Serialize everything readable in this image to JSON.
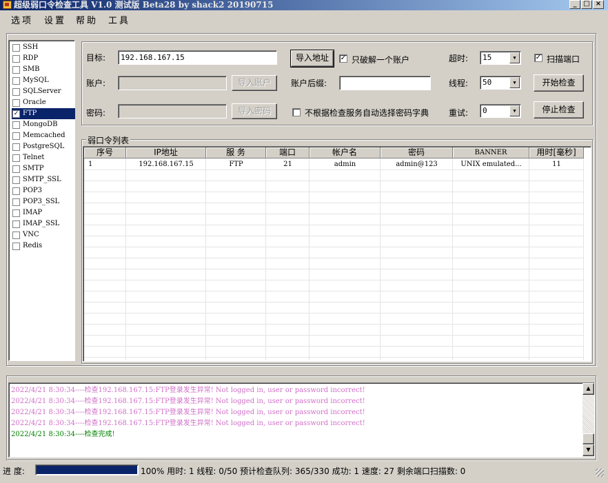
{
  "window": {
    "title": "超级弱口令检查工具 V1.0 测试版 Beta28 by shack2 20190715"
  },
  "menu": [
    "选项",
    "设置",
    "帮助",
    "工具"
  ],
  "services": [
    {
      "label": "SSH",
      "checked": false
    },
    {
      "label": "RDP",
      "checked": false
    },
    {
      "label": "SMB",
      "checked": false
    },
    {
      "label": "MySQL",
      "checked": false
    },
    {
      "label": "SQLServer",
      "checked": false
    },
    {
      "label": "Oracle",
      "checked": false
    },
    {
      "label": "FTP",
      "checked": true
    },
    {
      "label": "MongoDB",
      "checked": false
    },
    {
      "label": "Memcached",
      "checked": false
    },
    {
      "label": "PostgreSQL",
      "checked": false
    },
    {
      "label": "Telnet",
      "checked": false
    },
    {
      "label": "SMTP",
      "checked": false
    },
    {
      "label": "SMTP_SSL",
      "checked": false
    },
    {
      "label": "POP3",
      "checked": false
    },
    {
      "label": "POP3_SSL",
      "checked": false
    },
    {
      "label": "IMAP",
      "checked": false
    },
    {
      "label": "IMAP_SSL",
      "checked": false
    },
    {
      "label": "VNC",
      "checked": false
    },
    {
      "label": "Redis",
      "checked": false
    }
  ],
  "form": {
    "target_label": "目标:",
    "target_value": "192.168.167.15",
    "import_address": "导入地址",
    "only_one_account": "只破解一个账户",
    "account_label": "账户:",
    "account_value": "",
    "import_account": "导入账户",
    "account_suffix_label": "账户后缀:",
    "account_suffix_value": "",
    "password_label": "密码:",
    "password_value": "",
    "import_password": "导入密码",
    "auto_dict": "不根据检查服务自动选择密码字典",
    "timeout_label": "超时:",
    "timeout_value": "15",
    "scan_port": "扫描端口",
    "threads_label": "线程:",
    "threads_value": "50",
    "start_check": "开始检查",
    "retry_label": "重试:",
    "retry_value": "0",
    "stop_check": "停止检查"
  },
  "results": {
    "group_title": "弱口令列表",
    "columns": [
      "序号",
      "IP地址",
      "服 务",
      "端口",
      "帐户名",
      "密码",
      "BANNER",
      "用时[毫秒]"
    ],
    "rows": [
      [
        "1",
        "192.168.167.15",
        "FTP",
        "21",
        "admin",
        "admin@123",
        "UNIX emulated...",
        "11"
      ]
    ]
  },
  "log": [
    {
      "time": "2022/4/21 8:30:34",
      "sep": "----",
      "msg": "检查192.168.167.15:FTP登录发生异常!",
      "detail": "Not logged in, user or password incorrect!"
    },
    {
      "time": "2022/4/21 8:30:34",
      "sep": "----",
      "msg": "检查192.168.167.15:FTP登录发生异常!",
      "detail": "Not logged in, user or password incorrect!"
    },
    {
      "time": "2022/4/21 8:30:34",
      "sep": "----",
      "msg": "检查192.168.167.15:FTP登录发生异常!",
      "detail": "Not logged in, user or password incorrect!"
    },
    {
      "time": "2022/4/21 8:30:34",
      "sep": "----",
      "msg": "检查192.168.167.15:FTP登录发生异常!",
      "detail": "Not logged in, user or password incorrect!"
    },
    {
      "time": "2022/4/21 8:30:34",
      "sep": "----",
      "msg": "检查完成!",
      "detail": ""
    }
  ],
  "status": {
    "progress_label": "进 度:",
    "progress_fraction": 1.0,
    "text": "100% 用时: 1 线程: 0/50 预计检查队列: 365/330 成功: 1 速度: 27 剩余端口扫描数: 0"
  },
  "colors": {
    "titlebar_start": "#0a246a",
    "titlebar_end": "#a6caf0",
    "selection": "#0a246a",
    "log_error": "#d070c8",
    "log_done": "#008000",
    "progress": "#0a246a"
  }
}
